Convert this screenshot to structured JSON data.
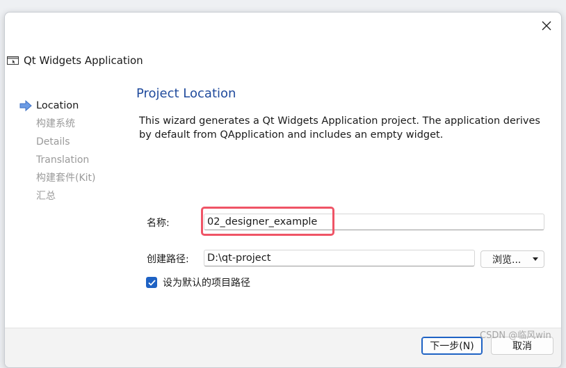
{
  "window": {
    "title": "Qt Widgets Application",
    "icon": "qt-app-window-icon",
    "close_icon": "close-icon"
  },
  "steps": [
    {
      "label": "Location",
      "current": true
    },
    {
      "label": "构建系统",
      "current": false
    },
    {
      "label": "Details",
      "current": false
    },
    {
      "label": "Translation",
      "current": false
    },
    {
      "label": "构建套件(Kit)",
      "current": false
    },
    {
      "label": "汇总",
      "current": false
    }
  ],
  "page": {
    "title": "Project Location",
    "description": "This wizard generates a Qt Widgets Application project. The application derives by default from QApplication and includes an empty widget."
  },
  "form": {
    "name_label": "名称:",
    "name_value": "02_designer_example",
    "path_label": "创建路径:",
    "path_value": "D:\\qt-project",
    "browse_label": "浏览...",
    "default_path_label": "设为默认的项目路径",
    "default_path_checked": true
  },
  "footer": {
    "next_label": "下一步(N)",
    "cancel_label": "取消"
  },
  "watermark": "CSDN @临风win",
  "colors": {
    "accent": "#1e62c4",
    "title_blue": "#1f4a9c",
    "highlight_red": "#ef5466"
  }
}
